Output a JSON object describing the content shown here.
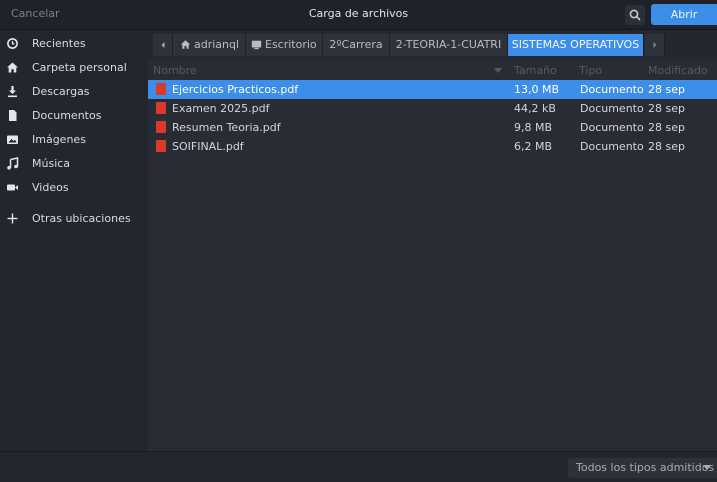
{
  "header": {
    "cancel_label": "Cancelar",
    "title": "Carga de archivos",
    "open_label": "Abrir"
  },
  "sidebar": {
    "items": [
      {
        "label": "Recientes",
        "icon": "clock-icon"
      },
      {
        "label": "Carpeta personal",
        "icon": "home-icon"
      },
      {
        "label": "Descargas",
        "icon": "download-icon"
      },
      {
        "label": "Documentos",
        "icon": "document-icon"
      },
      {
        "label": "Imágenes",
        "icon": "image-icon"
      },
      {
        "label": "Música",
        "icon": "music-icon"
      },
      {
        "label": "Videos",
        "icon": "video-icon"
      },
      {
        "label": "Otras ubicaciones",
        "icon": "plus-icon"
      }
    ]
  },
  "pathbar": {
    "crumbs": [
      "adrianql",
      "Escritorio",
      "2ºCarrera",
      "2-TEORIA-1-CUATRI",
      "SISTEMAS OPERATIVOS"
    ],
    "active_index": 4
  },
  "columns": {
    "name": "Nombre",
    "size": "Tamaño",
    "type": "Tipo",
    "modified": "Modificado"
  },
  "files": [
    {
      "name": "Ejercicios Practicos.pdf",
      "size": "13,0 MB",
      "type": "Documento",
      "modified": "28 sep",
      "selected": true
    },
    {
      "name": "Examen 2025.pdf",
      "size": "44,2 kB",
      "type": "Documento",
      "modified": "28 sep",
      "selected": false
    },
    {
      "name": "Resumen Teoria.pdf",
      "size": "9,8 MB",
      "type": "Documento",
      "modified": "28 sep",
      "selected": false
    },
    {
      "name": "SOIFINAL.pdf",
      "size": "6,2 MB",
      "type": "Documento",
      "modified": "28 sep",
      "selected": false
    }
  ],
  "filter": {
    "label": "Todos los tipos admitidos"
  },
  "colors": {
    "accent": "#3d8ee9",
    "pdf": "#d93a2c"
  }
}
